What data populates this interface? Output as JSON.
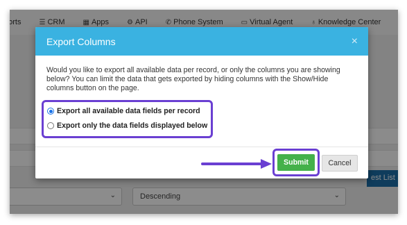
{
  "navbar": {
    "items": [
      {
        "label": "ports",
        "icon": ""
      },
      {
        "label": "CRM",
        "icon": "list-icon"
      },
      {
        "label": "Apps",
        "icon": "grid-icon"
      },
      {
        "label": "API",
        "icon": "settings-icon"
      },
      {
        "label": "Phone System",
        "icon": "phone-icon"
      },
      {
        "label": "Virtual Agent",
        "icon": "monitor-icon"
      },
      {
        "label": "Knowledge Center",
        "icon": "lightbulb-icon"
      }
    ]
  },
  "background": {
    "sort_order_value": "Descending",
    "partial_button": "est List"
  },
  "modal": {
    "title": "Export Columns",
    "close_symbol": "×",
    "description": "Would you like to export all available data per record, or only the columns you are showing below? You can limit the data that gets exported by hiding columns with the Show/Hide columns button on the page.",
    "options": [
      {
        "label": "Export all available data fields per record",
        "checked": true
      },
      {
        "label": "Export only the data fields displayed below",
        "checked": false
      }
    ],
    "submit_label": "Submit",
    "cancel_label": "Cancel"
  },
  "colors": {
    "header": "#3ab2e1",
    "highlight": "#6a3fd2",
    "submit": "#44b14a"
  }
}
